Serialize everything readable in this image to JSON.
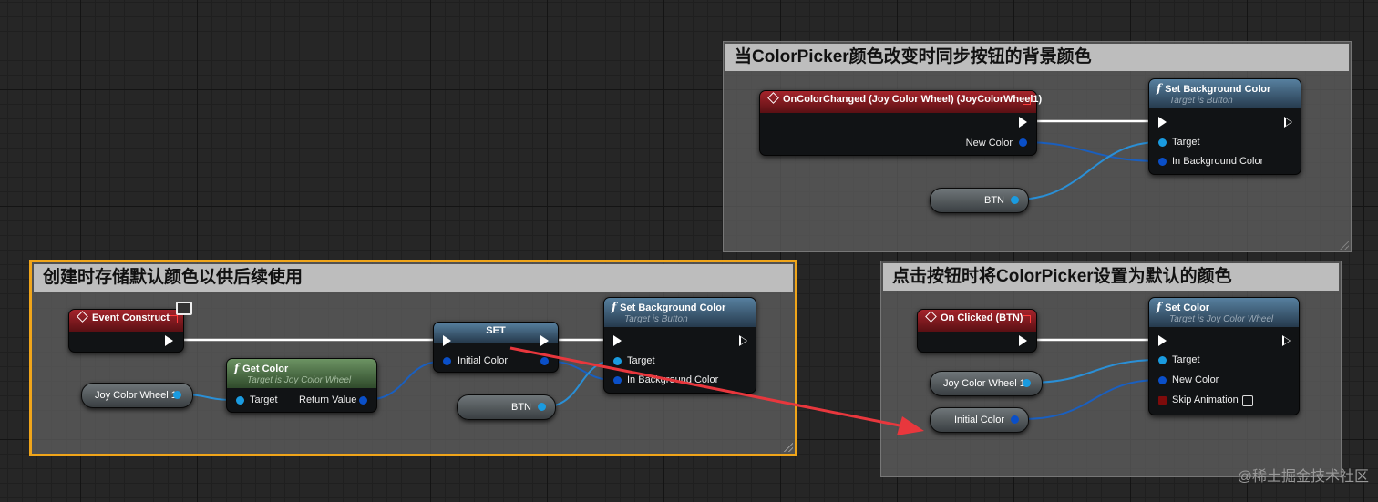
{
  "comments": {
    "top": "当ColorPicker颜色改变时同步按钮的背景颜色",
    "left": "创建时存储默认颜色以供后续使用",
    "right": "点击按钮时将ColorPicker设置为默认的颜色"
  },
  "nodes": {
    "on_color_changed": {
      "title": "OnColorChanged (Joy Color Wheel) (JoyColorWheel1)",
      "pin_new_color": "New Color"
    },
    "set_bg_top": {
      "title": "Set Background Color",
      "subtitle": "Target is Button",
      "pin_target": "Target",
      "pin_color": "In Background Color"
    },
    "btn_top": {
      "label": "BTN"
    },
    "event_construct": {
      "title": "Event Construct"
    },
    "get_color": {
      "title": "Get Color",
      "subtitle": "Target is Joy Color Wheel",
      "pin_target": "Target",
      "pin_return": "Return Value"
    },
    "joy_wheel_left": {
      "label": "Joy Color Wheel 1"
    },
    "set_var": {
      "title": "SET",
      "pin_initial": "Initial Color"
    },
    "btn_left": {
      "label": "BTN"
    },
    "set_bg_left": {
      "title": "Set Background Color",
      "subtitle": "Target is Button",
      "pin_target": "Target",
      "pin_color": "In Background Color"
    },
    "on_clicked": {
      "title": "On Clicked (BTN)"
    },
    "set_color": {
      "title": "Set Color",
      "subtitle": "Target is Joy Color Wheel",
      "pin_target": "Target",
      "pin_new_color": "New Color",
      "pin_skip": "Skip Animation"
    },
    "joy_wheel_right": {
      "label": "Joy Color Wheel 1"
    },
    "initial_color_var": {
      "label": "Initial Color"
    }
  },
  "watermark": "@稀土掘金技术社区",
  "colors": {
    "exec_wire": "#ffffff",
    "data_wire": "#1a5fbf",
    "arrow": "#e8373d",
    "selection": "#f0a51a"
  }
}
